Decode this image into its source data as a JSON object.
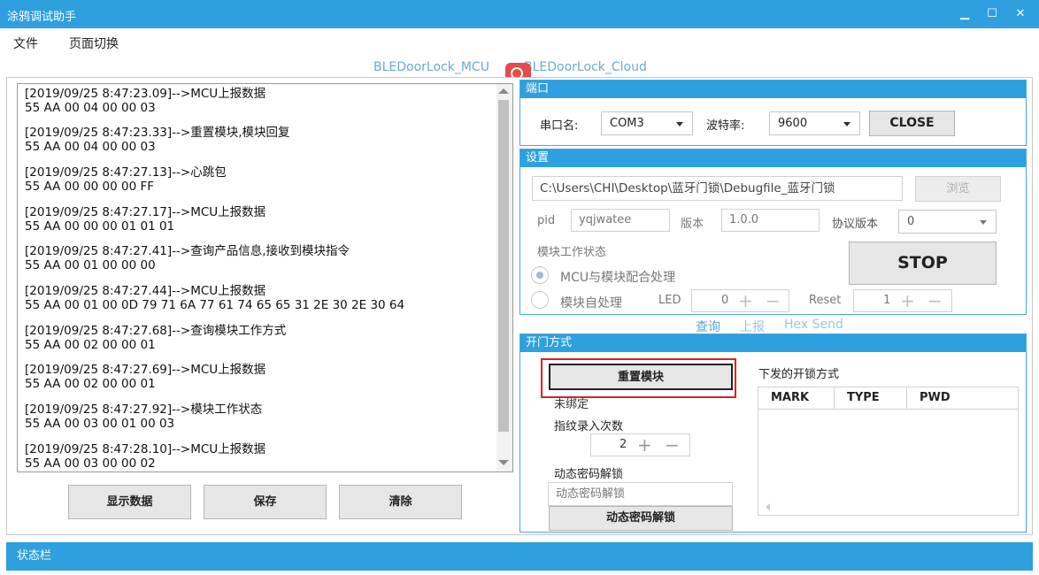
{
  "window": {
    "title": "涂鸦调试助手",
    "min_glyph": "▁",
    "max_glyph": "☐",
    "close_glyph": "✕"
  },
  "menu": [
    "文件",
    "页面切换"
  ],
  "top_tabs": [
    "BLEDoorLock_MCU",
    "BLEDoorLock_Cloud"
  ],
  "log": [
    {
      "line1": "[2019/09/25 8:47:23.09]-->MCU上报数据",
      "line2": "55 AA 00 04 00 00 03"
    },
    {
      "line1": "[2019/09/25 8:47:23.33]-->重置模块,模块回复",
      "line2": "55 AA 00 04 00 00 03"
    },
    {
      "line1": "[2019/09/25 8:47:27.13]-->心跳包",
      "line2": "55 AA 00 00 00 00 FF"
    },
    {
      "line1": "[2019/09/25 8:47:27.17]-->MCU上报数据",
      "line2": "55 AA 00 00 00 01 01 01"
    },
    {
      "line1": "[2019/09/25 8:47:27.41]-->查询产品信息,接收到模块指令",
      "line2": "55 AA 00 01 00 00 00"
    },
    {
      "line1": "[2019/09/25 8:47:27.44]-->MCU上报数据",
      "line2": "55 AA 00 01 00 0D 79 71 6A 77 61 74 65 65 31 2E 30 2E 30 64"
    },
    {
      "line1": "[2019/09/25 8:47:27.68]-->查询模块工作方式",
      "line2": "55 AA 00 02 00 00 01"
    },
    {
      "line1": "[2019/09/25 8:47:27.69]-->MCU上报数据",
      "line2": "55 AA 00 02 00 00 01"
    },
    {
      "line1": "[2019/09/25 8:47:27.92]-->模块工作状态",
      "line2": "55 AA 00 03 00 01 00 03"
    },
    {
      "line1": "[2019/09/25 8:47:28.10]-->MCU上报数据",
      "line2": "55 AA 00 03 00 00 02"
    }
  ],
  "log_buttons": {
    "show": "显示数据",
    "save": "保存",
    "clear": "清除"
  },
  "port": {
    "header": "端口",
    "port_label": "串口名:",
    "port_value": "COM3",
    "baud_label": "波特率:",
    "baud_value": "9600",
    "close_label": "CLOSE"
  },
  "settings": {
    "header": "设置",
    "path": "C:\\Users\\CHI\\Desktop\\蓝牙门锁\\Debugfile_蓝牙门锁",
    "browse_label": "浏览",
    "pid_label": "pid",
    "pid_value": "yqjwatee",
    "version_label": "版本",
    "version_value": "1.0.0",
    "protocol_label": "协议版本",
    "protocol_value": "0",
    "work_state_label": "模块工作状态",
    "stop_label": "STOP",
    "radio_mcu": "MCU与模块配合处理",
    "radio_self": "模块自处理",
    "led_label": "LED",
    "led_value": "0",
    "reset_label": "Reset",
    "reset_value": "1"
  },
  "mid_tabs": [
    "查询",
    "上报",
    "Hex Send"
  ],
  "door": {
    "header": "开门方式",
    "reset_module": "重置模块",
    "unbound": "未绑定",
    "fingerprint_label": "指纹录入次数",
    "fingerprint_value": "2",
    "dynamic_label": "动态密码解锁",
    "dynamic_placeholder": "动态密码解锁",
    "dynamic_button": "动态密码解锁",
    "unlock_methods_label": "下发的开锁方式",
    "table_columns": [
      "MARK",
      "TYPE",
      "PWD"
    ]
  },
  "statusbar": "状态栏",
  "colors": {
    "accent": "#2e9fdf",
    "highlight_red": "#e02020"
  }
}
